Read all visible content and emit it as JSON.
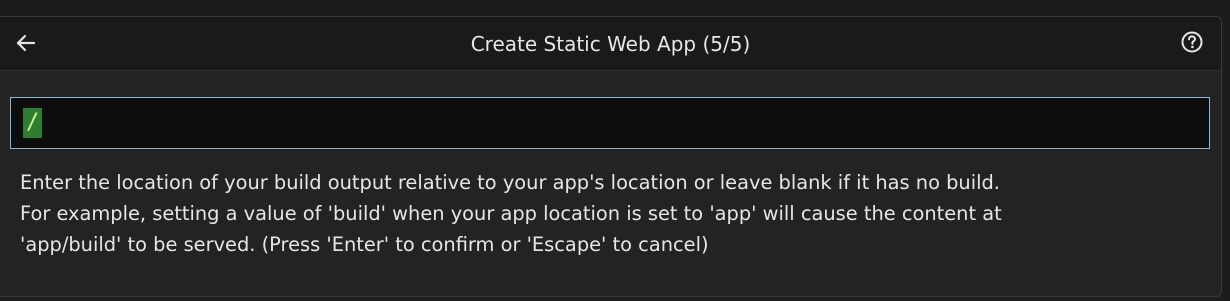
{
  "dialog": {
    "title": "Create Static Web App (5/5)",
    "back_icon": "arrow-left-icon",
    "help_icon": "question-circle-icon"
  },
  "input": {
    "value": "/"
  },
  "message": {
    "line1": "Enter the location of your build output relative to your app's location or leave blank if it has no build.",
    "line2": "For example, setting a value of 'build' when your app location is set to 'app' will cause the content at",
    "line3": "'app/build' to be served. (Press 'Enter' to confirm or 'Escape' to cancel)"
  },
  "colors": {
    "input_border": "#8eb4d6",
    "selection_bg": "#2f7d2f"
  }
}
